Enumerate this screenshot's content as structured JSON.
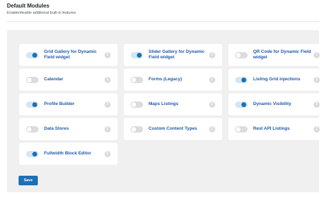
{
  "header": {
    "title": "Default Modules",
    "subtitle": "Enable/disable additional built-in features"
  },
  "modules": [
    {
      "label": "Grid Gallery for Dynamic Field widget",
      "enabled": true
    },
    {
      "label": "Slider Gallery for Dynamic Field widget",
      "enabled": true
    },
    {
      "label": "QR Code for Dynamic Field widget",
      "enabled": false
    },
    {
      "label": "Calendar",
      "enabled": false
    },
    {
      "label": "Forms (Legacy)",
      "enabled": false
    },
    {
      "label": "Listing Grid injections",
      "enabled": true
    },
    {
      "label": "Profile Builder",
      "enabled": true
    },
    {
      "label": "Maps Listings",
      "enabled": false
    },
    {
      "label": "Dynamic Visibility",
      "enabled": true
    },
    {
      "label": "Data Stores",
      "enabled": false
    },
    {
      "label": "Custom Content Types",
      "enabled": false
    },
    {
      "label": "Rest API Listings",
      "enabled": false
    },
    {
      "label": "Fullwidth Block Editor",
      "enabled": true
    }
  ],
  "info_glyph": "i",
  "save_label": "Save",
  "colors": {
    "accent": "#1e6fb5",
    "label": "#1e5aa8",
    "panel_bg": "#f0f0f1"
  }
}
